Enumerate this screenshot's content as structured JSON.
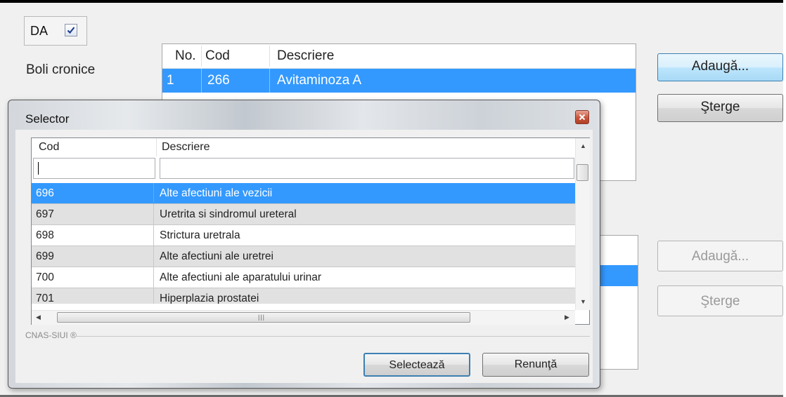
{
  "form": {
    "da_label": "DA",
    "da_checked": true,
    "boli_label": "Boli cronice",
    "grid": {
      "headers": [
        "No.",
        "Cod",
        "Descriere"
      ],
      "rows": [
        {
          "no": "1",
          "cod": "266",
          "descriere": "Avitaminoza A"
        }
      ]
    },
    "buttons": {
      "add": "Adaugă...",
      "delete": "Şterge",
      "add2": "Adaugă...",
      "delete2": "Şterge"
    }
  },
  "dialog": {
    "title": "Selector",
    "headers": [
      "Cod",
      "Descriere"
    ],
    "filter_value": "",
    "rows": [
      {
        "cod": "696",
        "descriere": "Alte afectiuni ale vezicii"
      },
      {
        "cod": "697",
        "descriere": "Uretrita si sindromul ureteral"
      },
      {
        "cod": "698",
        "descriere": "Strictura uretrala"
      },
      {
        "cod": "699",
        "descriere": "Alte afectiuni ale uretrei"
      },
      {
        "cod": "700",
        "descriere": "Alte afectiuni ale aparatului urinar"
      },
      {
        "cod": "701",
        "descriere": "Hiperplazia prostatei"
      }
    ],
    "group_label": "CNAS-SIUI ®",
    "select_button": "Selectează",
    "cancel_button": "Renunţă"
  },
  "colors": {
    "selection": "#3399ff",
    "alt_row": "#e1e1e1"
  }
}
